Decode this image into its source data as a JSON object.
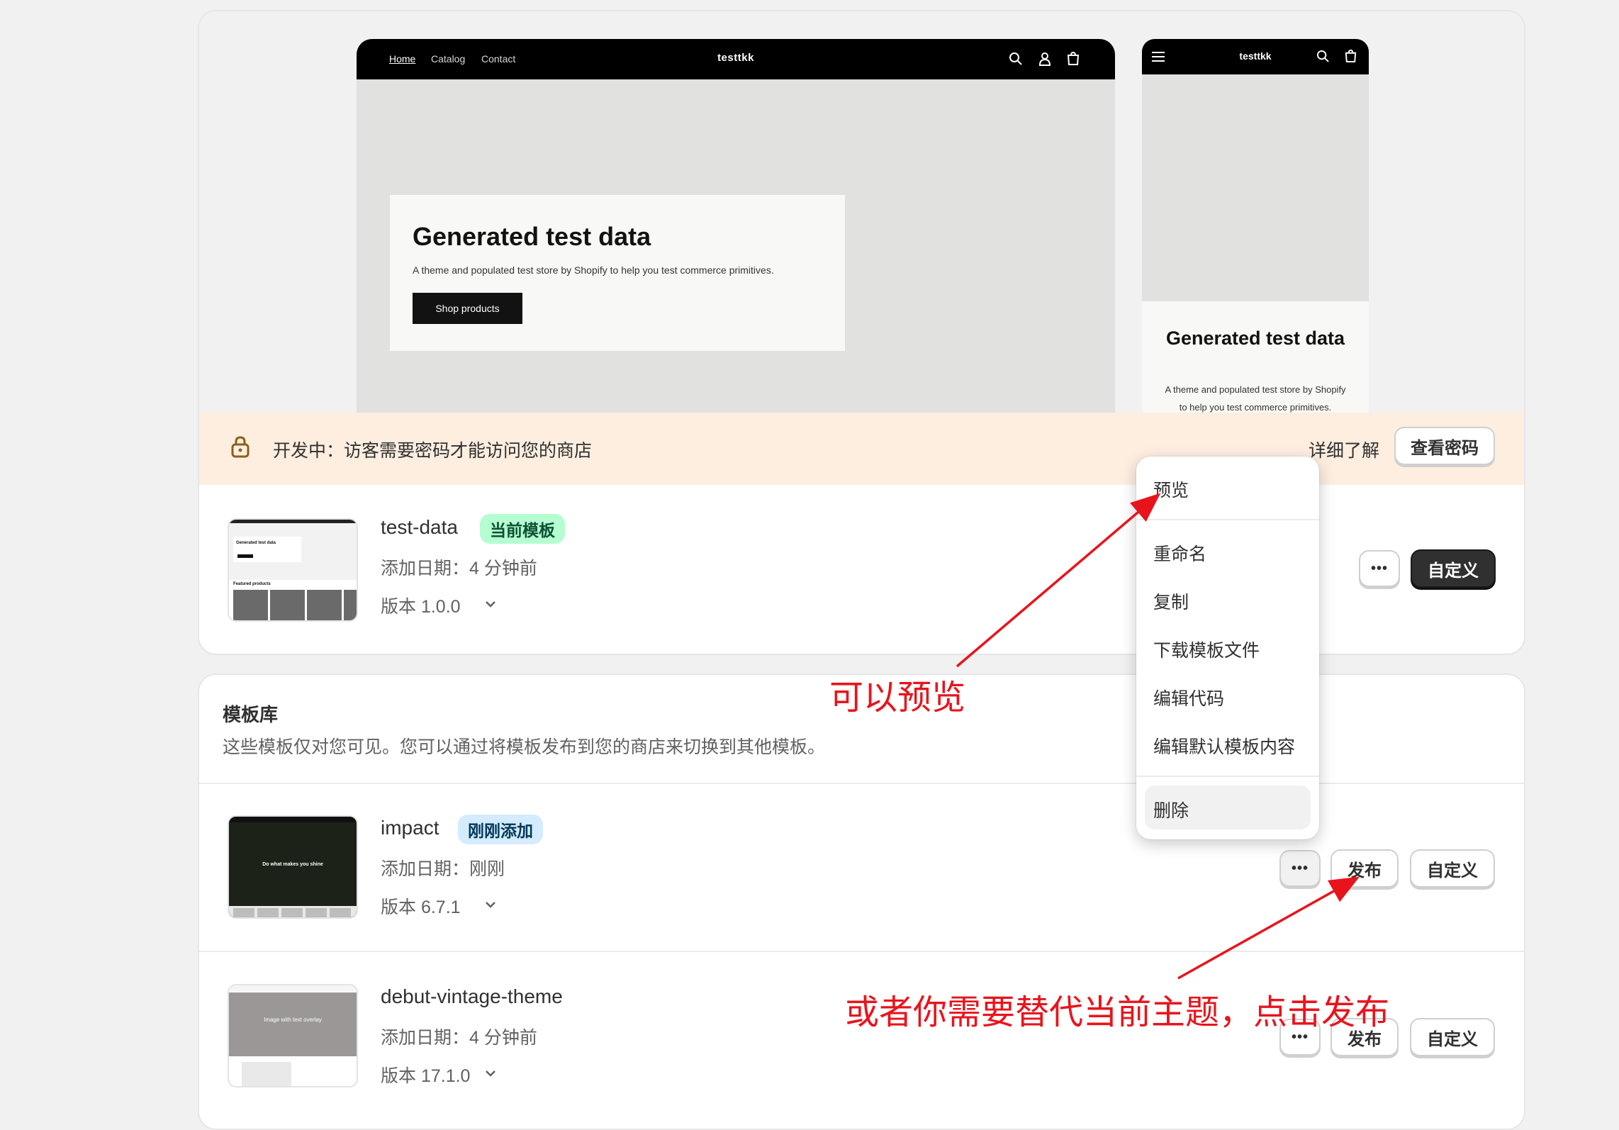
{
  "preview": {
    "desktop_nav": [
      "Home",
      "Catalog",
      "Contact"
    ],
    "store_name": "testtkk",
    "hero_title": "Generated test data",
    "hero_subtitle": "A theme and populated test store by Shopify to help you test commerce primitives.",
    "hero_button": "Shop products",
    "mobile_title": "Generated test data",
    "mobile_subtitle": "A theme and populated test store by Shopify to help you test commerce primitives."
  },
  "banner": {
    "text": "开发中：访客需要密码才能访问您的商店",
    "learn_more": "详细了解",
    "view_password": "查看密码"
  },
  "current_theme": {
    "name": "test-data",
    "badge": "当前模板",
    "added": "添加日期：4 分钟前",
    "version": "版本 1.0.0",
    "more_label": "•••",
    "customize": "自定义",
    "thumb_title": "Generated test data",
    "thumb_section": "Featured products"
  },
  "library": {
    "title": "模板库",
    "description": "这些模板仅对您可见。您可以通过将模板发布到您的商店来切换到其他模板。",
    "themes": [
      {
        "name": "impact",
        "badge": "刚刚添加",
        "added": "添加日期：刚刚",
        "version": "版本 6.7.1",
        "more_label": "•••",
        "publish": "发布",
        "customize": "自定义",
        "thumb_text": "Do what makes you shine"
      },
      {
        "name": "debut-vintage-theme",
        "added": "添加日期：4 分钟前",
        "version": "版本 17.1.0",
        "more_label": "•••",
        "publish": "发布",
        "customize": "自定义",
        "thumb_text": "Image with text overlay"
      }
    ]
  },
  "menu": {
    "items": [
      "预览",
      "重命名",
      "复制",
      "下载模板文件",
      "编辑代码",
      "编辑默认模板内容",
      "删除"
    ]
  },
  "annotations": {
    "preview_note": "可以预览",
    "publish_note": "或者你需要替代当前主题，点击发布",
    "color": "#e8141c"
  },
  "colors": {
    "banner_bg": "#fdeee0",
    "current_badge_bg": "#b4fed2",
    "new_badge_bg": "#d5ebff",
    "dark_button": "#303030"
  }
}
